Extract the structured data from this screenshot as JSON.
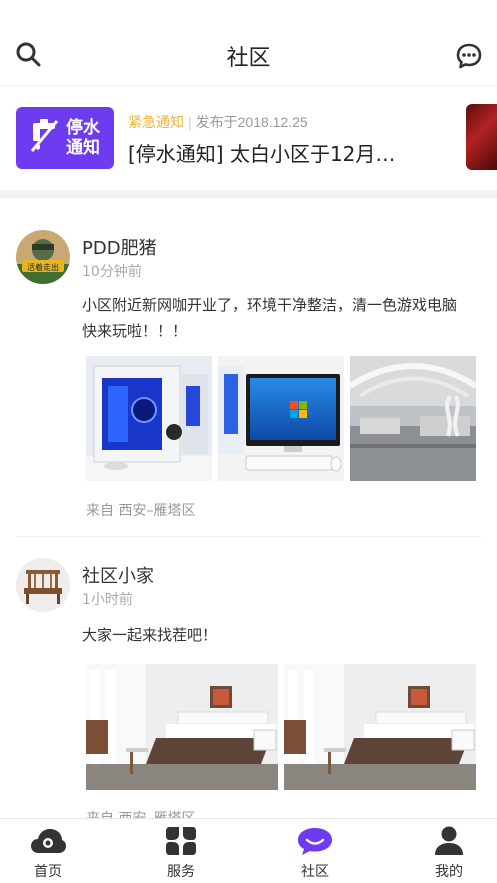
{
  "header": {
    "title": "社区"
  },
  "notice": {
    "thumb_label_line1": "停水",
    "thumb_label_line2": "通知",
    "tag": "紧急通知",
    "separator": "|",
    "published": "发布于2018.12.25",
    "title": "[停水通知] 太白小区于12月…"
  },
  "posts": [
    {
      "author": "PDD肥猪",
      "avatar_text": "活着走出",
      "time": "10分钟前",
      "content_line1": "小区附近新网咖开业了，环境干净整洁，清一色游戏电脑",
      "content_line2": "快来玩啦！！！",
      "location": "来自  西安–雁塔区"
    },
    {
      "author": "社区小家",
      "time": "1小时前",
      "content_line1": "大家一起来找茬吧！",
      "location": "来自  西安–雁塔区"
    }
  ],
  "tabbar": {
    "items": [
      {
        "label": "首页",
        "icon": "cloud-home-icon"
      },
      {
        "label": "服务",
        "icon": "services-grid-icon"
      },
      {
        "label": "社区",
        "icon": "community-chat-icon",
        "active": true
      },
      {
        "label": "我的",
        "icon": "user-icon"
      }
    ]
  },
  "colors": {
    "accent": "#6e3cf0",
    "urgent": "#f0b530"
  }
}
